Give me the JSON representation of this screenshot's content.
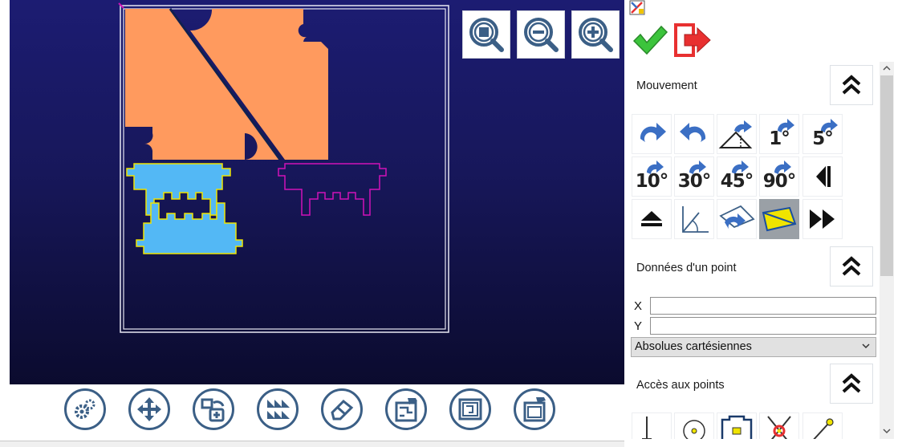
{
  "canvas": {
    "background_top": "#1c1c72",
    "background_bottom": "#0b0b2e",
    "piece_colors": {
      "orange": "#ff9a5e",
      "blue": "#53b8f5",
      "outline": "#d012b8",
      "highlight": "#f0e400"
    }
  },
  "zoom_buttons": [
    {
      "icon": "zoom-fit-icon"
    },
    {
      "icon": "zoom-out-icon"
    },
    {
      "icon": "zoom-in-icon"
    }
  ],
  "bottom_toolbar": {
    "tools": [
      {
        "icon": "gear-settings-icon"
      },
      {
        "icon": "move-arrows-icon"
      },
      {
        "icon": "duplicate-icon"
      },
      {
        "icon": "nesting-icon"
      },
      {
        "icon": "eraser-icon"
      },
      {
        "icon": "edit-pieces-icon"
      },
      {
        "icon": "sheet-icon"
      },
      {
        "icon": "export-sheet-icon"
      }
    ]
  },
  "panel": {
    "accent_color": "#3b6fc4",
    "actions": [
      {
        "icon": "validate-check-icon",
        "color": "#3cc43c"
      },
      {
        "icon": "exit-icon",
        "color": "#e83030"
      }
    ],
    "sections": {
      "movement": {
        "title": "Mouvement"
      },
      "point_data": {
        "title": "Données d'un point"
      },
      "point_access": {
        "title": "Accès aux points"
      }
    },
    "movement_buttons": [
      {
        "icon": "rotate-right-icon"
      },
      {
        "icon": "rotate-left-icon"
      },
      {
        "icon": "rotate-to-edge-icon"
      },
      {
        "icon": "rotate-step-icon",
        "label": "1°"
      },
      {
        "icon": "rotate-step-icon",
        "label": "5°"
      },
      {
        "icon": "rotate-step-icon",
        "label": "10°"
      },
      {
        "icon": "rotate-step-icon",
        "label": "30°"
      },
      {
        "icon": "rotate-step-icon",
        "label": "45°"
      },
      {
        "icon": "rotate-step-icon",
        "label": "90°"
      },
      {
        "icon": "flip-horizontal-icon"
      },
      {
        "icon": "flip-vertical-icon"
      },
      {
        "icon": "angle-icon"
      },
      {
        "icon": "align-rotate-icon"
      },
      {
        "icon": "parallelogram-select-icon",
        "selected": true
      },
      {
        "icon": "fast-forward-icon"
      }
    ],
    "point_fields": {
      "x_label": "X",
      "x_value": "",
      "y_label": "Y",
      "y_value": ""
    },
    "coordinate_mode": {
      "selected": "Absolues cartésiennes"
    },
    "point_access_buttons": [
      {
        "icon": "snap-perpendicular-icon"
      },
      {
        "icon": "snap-center-icon"
      },
      {
        "icon": "snap-outline-icon"
      },
      {
        "icon": "snap-intersection-icon"
      },
      {
        "icon": "snap-endpoint-icon"
      }
    ]
  }
}
